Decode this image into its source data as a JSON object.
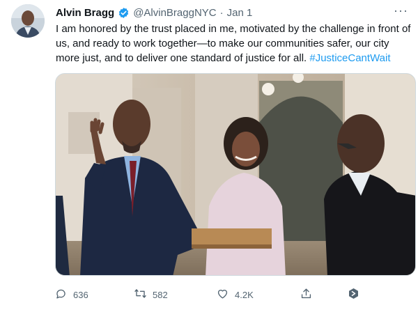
{
  "tweet": {
    "author_name": "Alvin Bragg",
    "handle": "@AlvinBraggNYC",
    "separator": "·",
    "date": "Jan 1",
    "more_label": "···",
    "text": "I am honored by the trust placed in me, motivated by the challenge in front of us, and ready to work together—to make our communities safer, our city more just, and to deliver one standard of justice for all. ",
    "hashtag": "#JusticeCantWait"
  },
  "actions": {
    "replies": "636",
    "retweets": "582",
    "likes": "4.2K"
  },
  "colors": {
    "link": "#1d9bf0",
    "verified": "#1d9bf0",
    "muted": "#536471",
    "text": "#0f1419"
  },
  "icons": [
    "verified-badge-icon",
    "more-icon",
    "reply-icon",
    "retweet-icon",
    "like-icon",
    "share-icon",
    "extension-icon"
  ]
}
